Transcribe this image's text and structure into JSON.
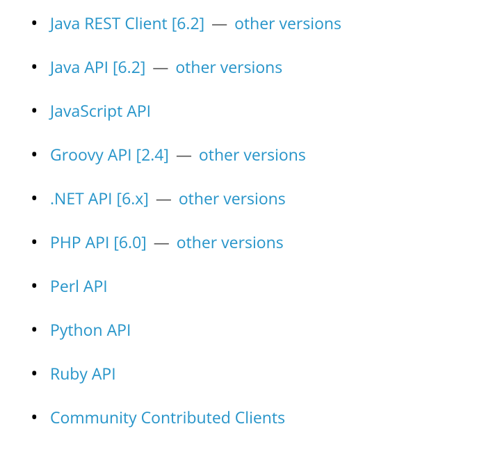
{
  "separator": "—",
  "other_versions_label": "other versions",
  "items": [
    {
      "label": "Java REST Client [6.2]",
      "has_other_versions": true
    },
    {
      "label": "Java API [6.2]",
      "has_other_versions": true
    },
    {
      "label": "JavaScript API",
      "has_other_versions": false
    },
    {
      "label": "Groovy API [2.4]",
      "has_other_versions": true
    },
    {
      "label": ".NET API [6.x]",
      "has_other_versions": true
    },
    {
      "label": "PHP API [6.0]",
      "has_other_versions": true
    },
    {
      "label": "Perl API",
      "has_other_versions": false
    },
    {
      "label": "Python API",
      "has_other_versions": false
    },
    {
      "label": "Ruby API",
      "has_other_versions": false
    },
    {
      "label": "Community Contributed Clients",
      "has_other_versions": false
    }
  ]
}
